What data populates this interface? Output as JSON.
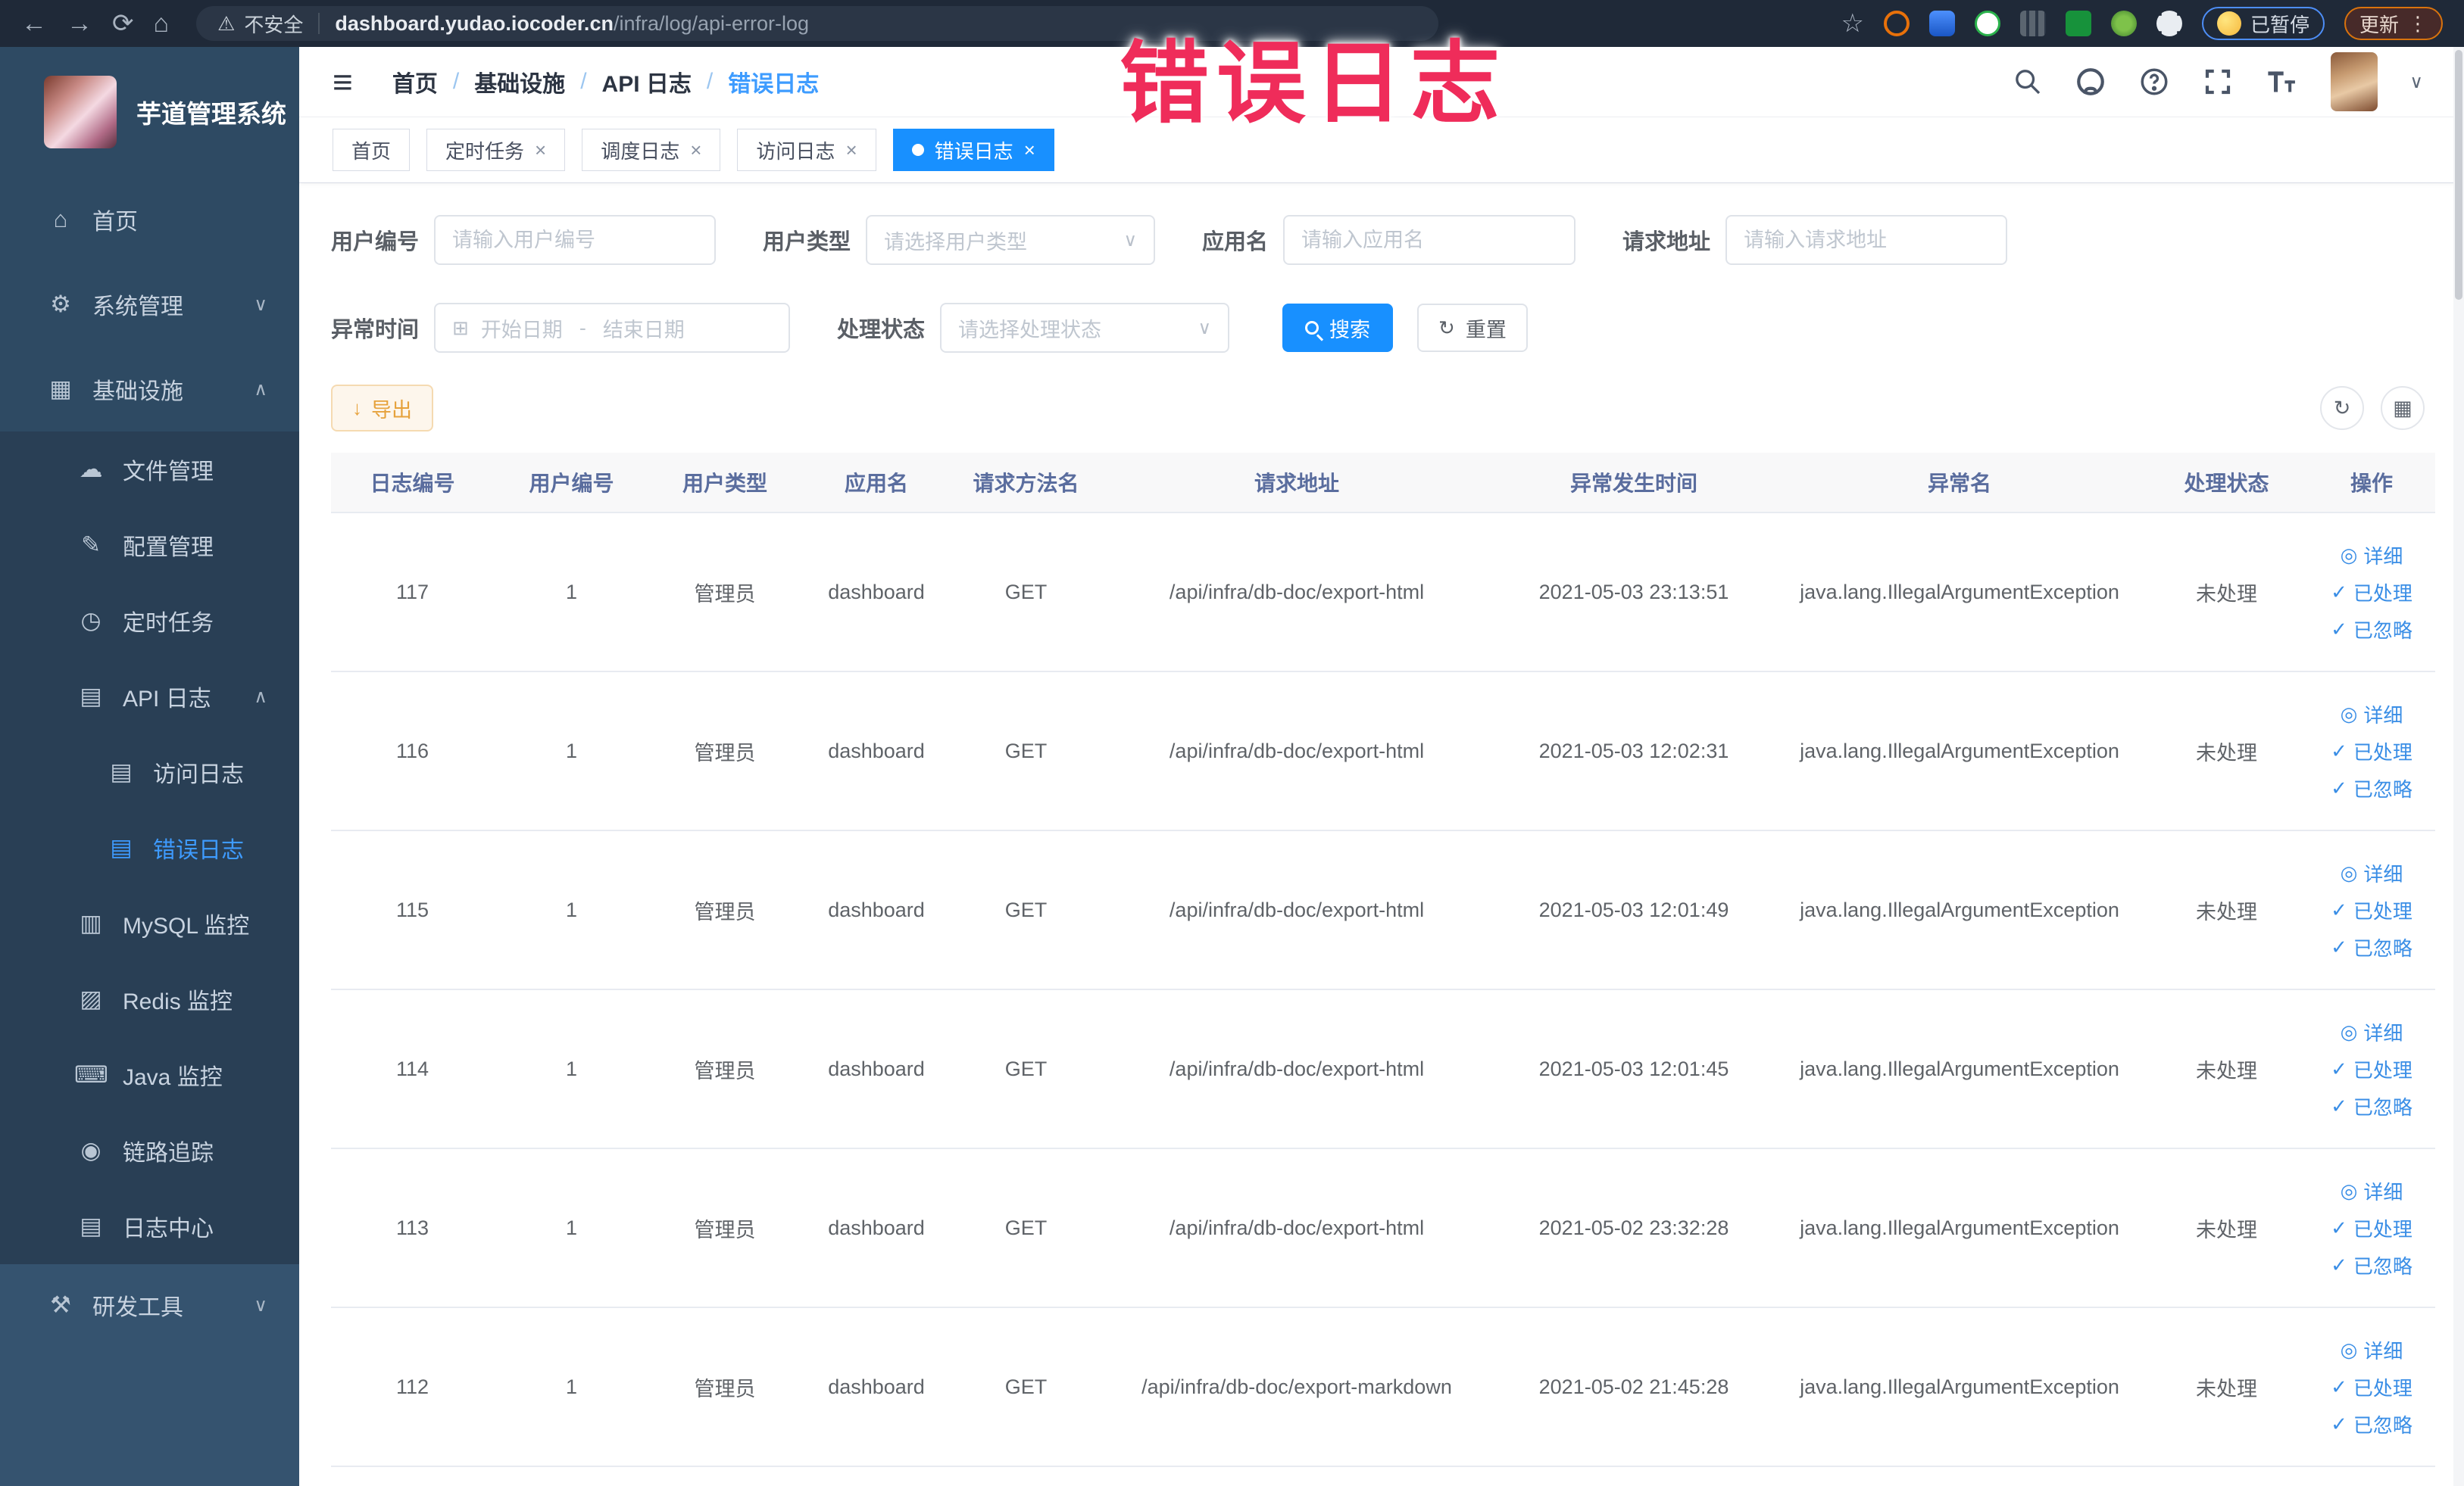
{
  "annotation": {
    "text": "错误日志"
  },
  "browser": {
    "security_label": "不安全",
    "url_domain": "dashboard.yudao.iocoder.cn",
    "url_path": "/infra/log/api-error-log",
    "paused_badge": "已暂停",
    "update_button": "更新",
    "kebab_glyph": "⋮",
    "star_glyph": "☆",
    "warning_glyph": "⚠",
    "nav_glyphs": {
      "back": "←",
      "forward": "→",
      "reload": "⟳",
      "home": "⌂"
    }
  },
  "sidebar": {
    "title": "芋道管理系统",
    "top_items": [
      {
        "name": "home",
        "icon": "home-icon",
        "glyph": "⌂",
        "label": "首页",
        "level": 0
      },
      {
        "name": "system-management",
        "icon": "gear-icon",
        "glyph": "⚙",
        "label": "系统管理",
        "level": 0,
        "chevron": "∨"
      },
      {
        "name": "infrastructure",
        "icon": "monitor-icon",
        "glyph": "▦",
        "label": "基础设施",
        "level": 0,
        "chevron": "∧"
      }
    ],
    "sub_items": [
      {
        "name": "file-management",
        "icon": "cloud-icon",
        "glyph": "☁",
        "label": "文件管理",
        "level": 1
      },
      {
        "name": "config-management",
        "icon": "edit-icon",
        "glyph": "✎",
        "label": "配置管理",
        "level": 1
      },
      {
        "name": "scheduled-tasks",
        "icon": "timer-icon",
        "glyph": "◷",
        "label": "定时任务",
        "level": 1
      },
      {
        "name": "api-log",
        "icon": "log-icon",
        "glyph": "▤",
        "label": "API 日志",
        "level": 1,
        "chevron": "∧"
      },
      {
        "name": "access-log",
        "icon": "log-icon",
        "glyph": "▤",
        "label": "访问日志",
        "level": 2
      },
      {
        "name": "error-log",
        "icon": "log-icon",
        "glyph": "▤",
        "label": "错误日志",
        "level": 2,
        "active": true
      },
      {
        "name": "mysql-monitor",
        "icon": "database-icon",
        "glyph": "▥",
        "label": "MySQL 监控",
        "level": 1
      },
      {
        "name": "redis-monitor",
        "icon": "stack-icon",
        "glyph": "▨",
        "label": "Redis 监控",
        "level": 1
      },
      {
        "name": "java-monitor",
        "icon": "terminal-icon",
        "glyph": "⌨",
        "label": "Java 监控",
        "level": 1
      },
      {
        "name": "trace",
        "icon": "eye-icon",
        "glyph": "◉",
        "label": "链路追踪",
        "level": 1
      },
      {
        "name": "log-center",
        "icon": "log-icon",
        "glyph": "▤",
        "label": "日志中心",
        "level": 1
      }
    ],
    "bottom_items": [
      {
        "name": "dev-tools",
        "icon": "toolbox-icon",
        "glyph": "⚒",
        "label": "研发工具",
        "level": 0,
        "chevron": "∨"
      }
    ]
  },
  "header": {
    "breadcrumb": [
      "首页",
      "基础设施",
      "API 日志",
      "错误日志"
    ],
    "separator": "/"
  },
  "tabs": [
    {
      "name": "home",
      "label": "首页"
    },
    {
      "name": "job",
      "label": "定时任务",
      "closable": true
    },
    {
      "name": "job-log",
      "label": "调度日志",
      "closable": true
    },
    {
      "name": "access-log",
      "label": "访问日志",
      "closable": true
    },
    {
      "name": "error-log",
      "label": "错误日志",
      "closable": true,
      "active": true
    }
  ],
  "filters": {
    "user_id_label": "用户编号",
    "user_id_placeholder": "请输入用户编号",
    "user_type_label": "用户类型",
    "user_type_placeholder": "请选择用户类型",
    "app_name_label": "应用名",
    "app_name_placeholder": "请输入应用名",
    "request_url_label": "请求地址",
    "request_url_placeholder": "请输入请求地址",
    "exception_time_label": "异常时间",
    "date_start_placeholder": "开始日期",
    "date_separator": "-",
    "date_end_placeholder": "结束日期",
    "process_status_label": "处理状态",
    "process_status_placeholder": "请选择处理状态",
    "search_button": "搜索",
    "reset_button": "重置",
    "select_caret_glyph": "∨",
    "calendar_glyph": "⊞",
    "reset_glyph": "↻"
  },
  "toolbar": {
    "export_button": "导出",
    "export_glyph": "↓",
    "refresh_glyph": "↻",
    "columns_glyph": "▦"
  },
  "table": {
    "headers": [
      "日志编号",
      "用户编号",
      "用户类型",
      "应用名",
      "请求方法名",
      "请求地址",
      "异常发生时间",
      "异常名",
      "处理状态",
      "操作"
    ],
    "action_labels": {
      "detail": "详细",
      "processed": "已处理",
      "ignored": "已忽略"
    },
    "action_glyphs": {
      "detail": "◎",
      "check": "✓"
    },
    "rows": [
      {
        "id": "117",
        "user_id": "1",
        "user_type": "管理员",
        "app_name": "dashboard",
        "method": "GET",
        "url": "/api/infra/db-doc/export-html",
        "time": "2021-05-03 23:13:51",
        "exception": "java.lang.IllegalArgumentException",
        "status": "未处理"
      },
      {
        "id": "116",
        "user_id": "1",
        "user_type": "管理员",
        "app_name": "dashboard",
        "method": "GET",
        "url": "/api/infra/db-doc/export-html",
        "time": "2021-05-03 12:02:31",
        "exception": "java.lang.IllegalArgumentException",
        "status": "未处理"
      },
      {
        "id": "115",
        "user_id": "1",
        "user_type": "管理员",
        "app_name": "dashboard",
        "method": "GET",
        "url": "/api/infra/db-doc/export-html",
        "time": "2021-05-03 12:01:49",
        "exception": "java.lang.IllegalArgumentException",
        "status": "未处理"
      },
      {
        "id": "114",
        "user_id": "1",
        "user_type": "管理员",
        "app_name": "dashboard",
        "method": "GET",
        "url": "/api/infra/db-doc/export-html",
        "time": "2021-05-03 12:01:45",
        "exception": "java.lang.IllegalArgumentException",
        "status": "未处理"
      },
      {
        "id": "113",
        "user_id": "1",
        "user_type": "管理员",
        "app_name": "dashboard",
        "method": "GET",
        "url": "/api/infra/db-doc/export-html",
        "time": "2021-05-02 23:32:28",
        "exception": "java.lang.IllegalArgumentException",
        "status": "未处理"
      },
      {
        "id": "112",
        "user_id": "1",
        "user_type": "管理员",
        "app_name": "dashboard",
        "method": "GET",
        "url": "/api/infra/db-doc/export-markdown",
        "time": "2021-05-02 21:45:28",
        "exception": "java.lang.IllegalArgumentException",
        "status": "未处理"
      }
    ]
  },
  "colors": {
    "accent": "#1890ff",
    "link": "#3a8ee6",
    "warning": "#e6a23c",
    "sidebar_bg": "#2e4a63",
    "sidebar_sub_bg": "#293f55",
    "annotation": "#ef2c5a"
  }
}
